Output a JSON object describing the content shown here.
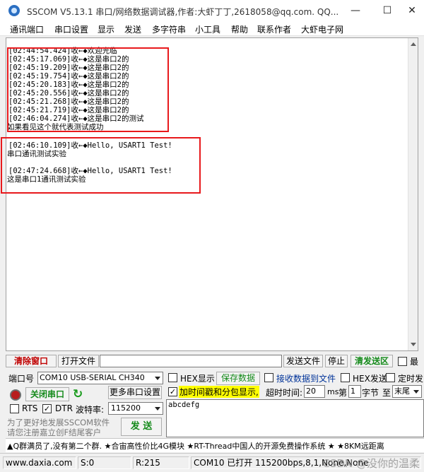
{
  "window": {
    "title": "SSCOM V5.13.1 串口/网络数据调试器,作者:大虾丁丁,2618058@qq.com. QQ...",
    "minimize": "—",
    "maximize": "☐",
    "close": "✕"
  },
  "menu": [
    "通讯端口",
    "串口设置",
    "显示",
    "发送",
    "多字符串",
    "小工具",
    "帮助",
    "联系作者",
    "大虾电子网"
  ],
  "receive": {
    "lines": [
      "[02:44:54.424]收←◆欢迎光临",
      "[02:45:17.069]收←◆这是串口2的",
      "[02:45:19.209]收←◆这是串口2的",
      "[02:45:19.754]收←◆这是串口2的",
      "[02:45:20.183]收←◆这是串口2的",
      "[02:45:20.556]收←◆这是串口2的",
      "[02:45:21.268]收←◆这是串口2的",
      "[02:45:21.719]收←◆这是串口2的",
      "[02:46:04.274]收←◆这是串口2的测试",
      "如果看见这个就代表测试成功",
      "",
      "[02:46:10.109]收←◆Hello, USART1 Test!",
      "串口通讯测试实验",
      "",
      "[02:47:24.668]收←◆Hello, USART1 Test!",
      "这是串口1通讯测试实验"
    ]
  },
  "controls": {
    "clear_window": "清除窗口",
    "open_file": "打开文件",
    "send_file": "发送文件",
    "stop": "停止",
    "clear_send": "清发送区",
    "last_cut": "最",
    "port_label": "端口号",
    "port_value": "COM10 USB-SERIAL CH340",
    "close_port": "关闭串口",
    "more_settings": "更多串口设置",
    "rts": "RTS",
    "dtr": "DTR",
    "baud_label": "波特率:",
    "baud_value": "115200",
    "hex_show": "HEX显示",
    "save_data": "保存数据",
    "recv_to_file": "接收数据到文件",
    "hex_send": "HEX发送",
    "timed_send": "定时发",
    "timestamp": "加时间戳和分包显示,",
    "timeout_label": "超时时间:",
    "timeout_value": "20",
    "ms": "ms",
    "nth": "第",
    "byte_value": "1",
    "byte_unit": "字节",
    "to": "至",
    "end_value": "末尾",
    "send_text": "abcdefg",
    "promo_1": "为了更好地发展SSCOM软件",
    "promo_2": "请您注册嘉立创F结尾客户",
    "send_button": "发 送"
  },
  "ticker": "▲Q群满员了,没有第二个群. ★合宙高性价比4G模块 ★RT-Thread中国人的开源免费操作系统 ★ ★8KM远距离",
  "status": {
    "website": "www.daxia.com",
    "s": "S:0",
    "r": "R:215",
    "port_state": "COM10 已打开  115200bps,8,1,None,None",
    "watermark": "CSDN @没你的温柔"
  },
  "colors": {
    "highlight_box": "#e8191c",
    "green_label": "#158a1b",
    "red_label": "#c00000"
  }
}
